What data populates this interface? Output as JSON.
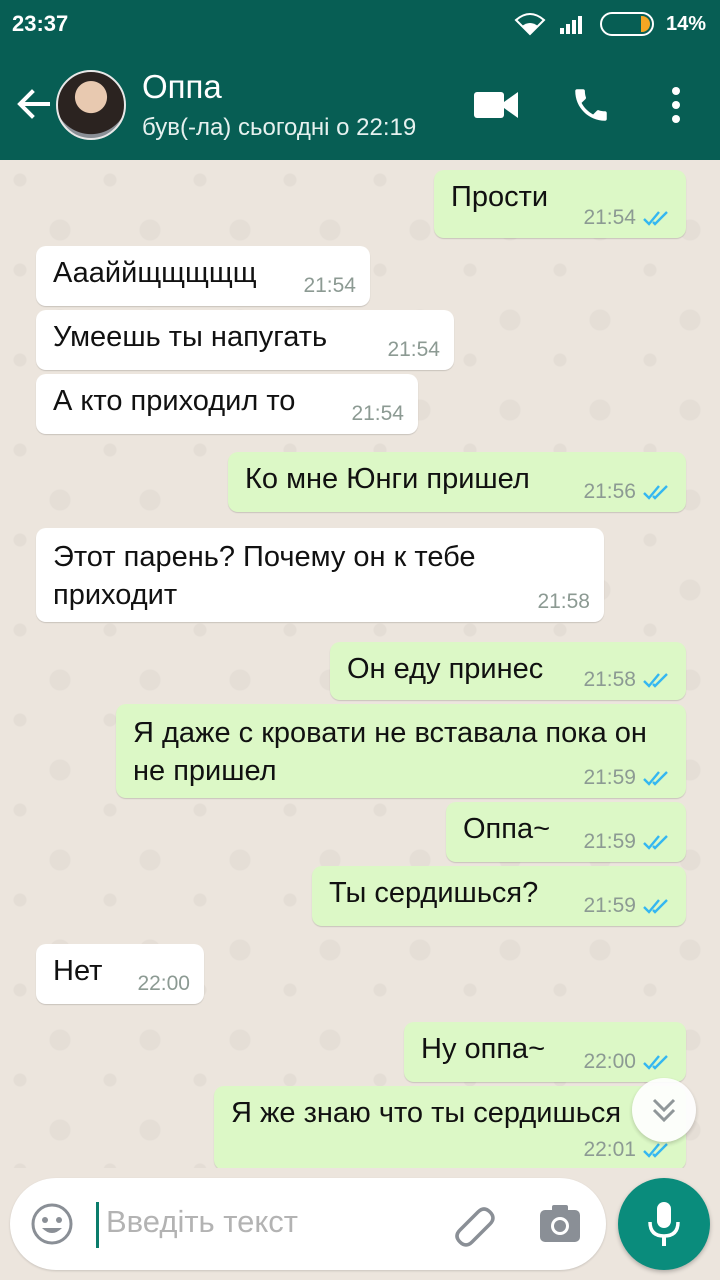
{
  "status_bar": {
    "time": "23:37",
    "battery": "14%"
  },
  "header": {
    "contact_name": "Оппа",
    "last_seen": "був(-ла) сьогодні о 22:19"
  },
  "messages": [
    {
      "dir": "out",
      "text": "Прости",
      "time": "21:54",
      "read": true
    },
    {
      "dir": "in",
      "text": "Аааййщщщщщ",
      "time": "21:54"
    },
    {
      "dir": "in",
      "text": "Умеешь ты напугать",
      "time": "21:54"
    },
    {
      "dir": "in",
      "text": "А кто приходил то",
      "time": "21:54"
    },
    {
      "dir": "out",
      "text": "Ко мне Юнги пришел",
      "time": "21:56",
      "read": true
    },
    {
      "dir": "in",
      "text": "Этот парень? Почему он к тебе приходит",
      "time": "21:58"
    },
    {
      "dir": "out",
      "text": "Он еду принес",
      "time": "21:58",
      "read": true
    },
    {
      "dir": "out",
      "text": "Я даже с кровати не вставала пока он не пришел",
      "time": "21:59",
      "read": true
    },
    {
      "dir": "out",
      "text": "Оппа~",
      "time": "21:59",
      "read": true
    },
    {
      "dir": "out",
      "text": "Ты сердишься?",
      "time": "21:59",
      "read": true
    },
    {
      "dir": "in",
      "text": "Нет",
      "time": "22:00"
    },
    {
      "dir": "out",
      "text": "Ну оппа~",
      "time": "22:00",
      "read": true
    },
    {
      "dir": "out",
      "text": "Я же знаю что ты сердишься",
      "time": "22:01",
      "read": true
    }
  ],
  "input": {
    "placeholder": "Введіть текст"
  },
  "colors": {
    "header": "#075e54",
    "outgoing": "#dcf8c6",
    "incoming": "#ffffff",
    "read_ticks": "#34b7f1",
    "mic": "#0a8c7c"
  },
  "icons": [
    "back-arrow-icon",
    "video-call-icon",
    "phone-icon",
    "more-vert-icon",
    "emoji-icon",
    "attach-icon",
    "camera-icon",
    "mic-icon",
    "chevron-double-down-icon"
  ]
}
